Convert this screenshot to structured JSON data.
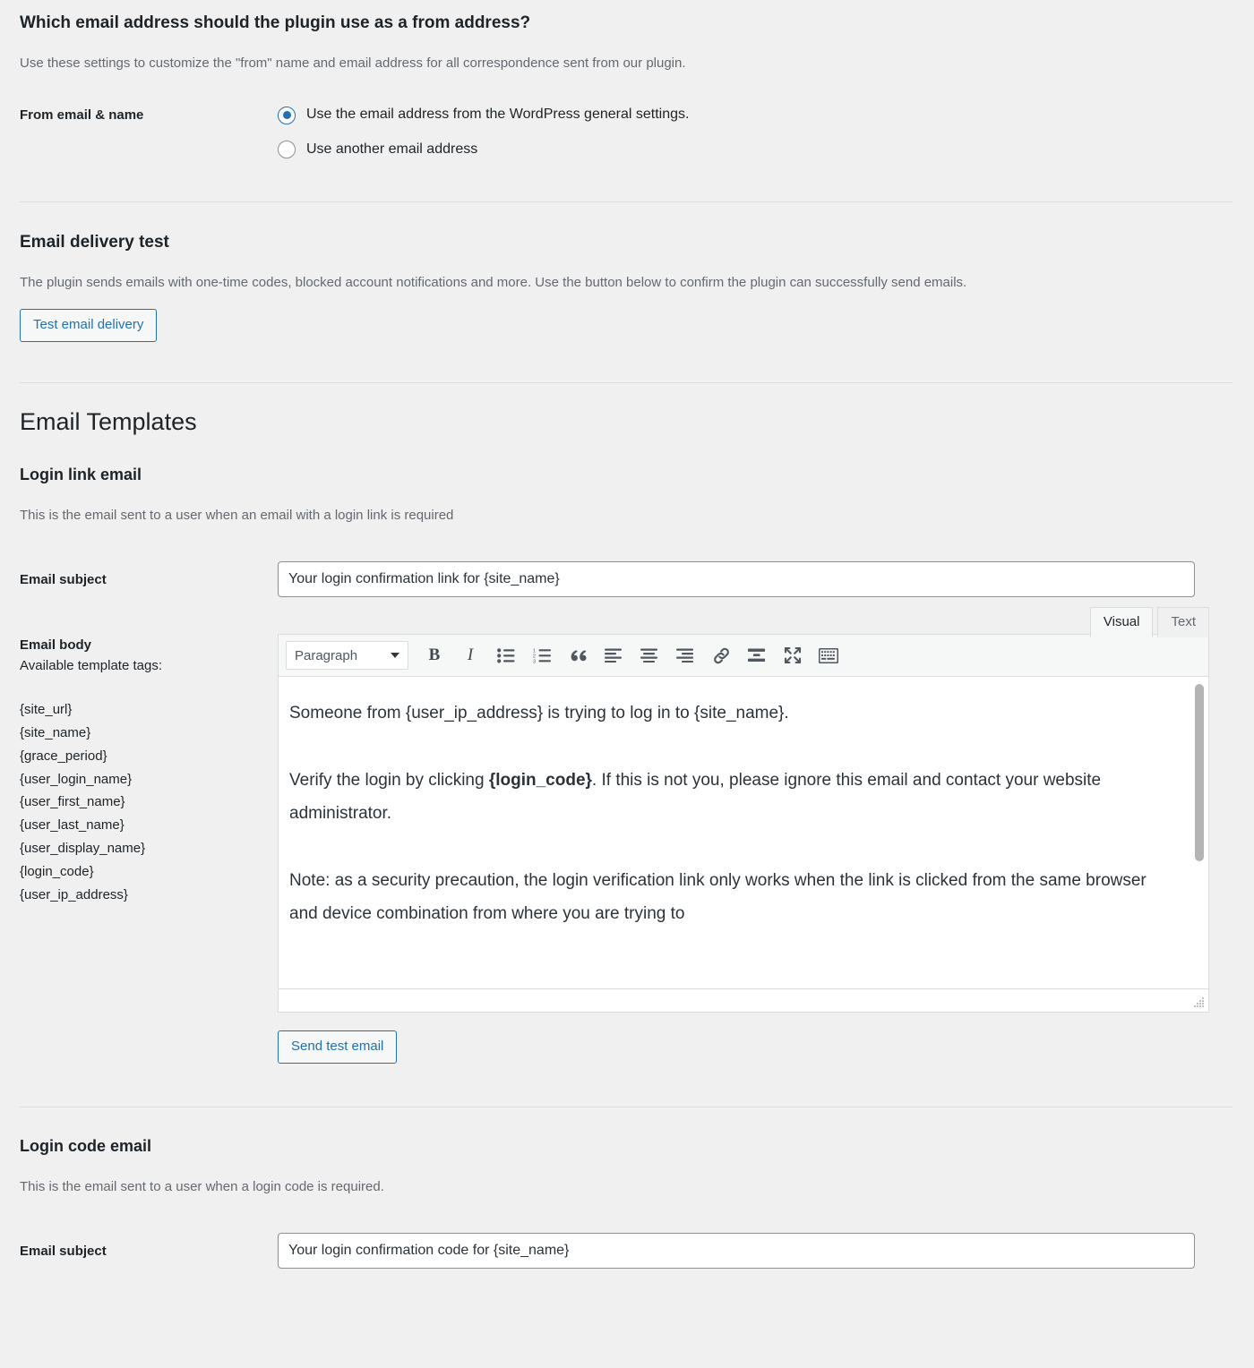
{
  "from_address_section": {
    "heading": "Which email address should the plugin use as a from address?",
    "description": "Use these settings to customize the \"from\" name and email address for all correspondence sent from our plugin.",
    "field_label": "From email & name",
    "options": [
      {
        "label": "Use the email address from the WordPress general settings.",
        "selected": true
      },
      {
        "label": "Use another email address",
        "selected": false
      }
    ]
  },
  "delivery_test_section": {
    "heading": "Email delivery test",
    "description": "The plugin sends emails with one-time codes, blocked account notifications and more. Use the button below to confirm the plugin can successfully send emails.",
    "button_label": "Test email delivery"
  },
  "email_templates": {
    "heading": "Email Templates",
    "login_link_email": {
      "heading": "Login link email",
      "description": "This is the email sent to a user when an email with a login link is required",
      "subject_label": "Email subject",
      "subject_value": "Your login confirmation link for {site_name}",
      "body_label": "Email body",
      "tags_label": "Available template tags:",
      "tags": [
        "{site_url}",
        "{site_name}",
        "{grace_period}",
        "{user_login_name}",
        "{user_first_name}",
        "{user_last_name}",
        "{user_display_name}",
        "{login_code}",
        "{user_ip_address}"
      ],
      "editor": {
        "tabs": [
          {
            "label": "Visual",
            "active": true
          },
          {
            "label": "Text",
            "active": false
          }
        ],
        "format_select_value": "Paragraph",
        "toolbar_buttons": [
          "bold-icon",
          "italic-icon",
          "bulleted-list-icon",
          "numbered-list-icon",
          "blockquote-icon",
          "align-left-icon",
          "align-center-icon",
          "align-right-icon",
          "link-icon",
          "insert-read-more-icon",
          "fullscreen-icon",
          "toolbar-toggle-icon"
        ],
        "paragraphs": [
          {
            "before": "Someone from {user_ip_address} is trying to log in to {site_name}.",
            "bold": "",
            "after": ""
          },
          {
            "before": "Verify the login by clicking ",
            "bold": "{login_code}",
            "after": ". If this is not you, please ignore this email and contact your website administrator."
          },
          {
            "before": "Note: as a security precaution, the login verification link only works when the link is clicked from the same browser and device combination from where you are trying to",
            "bold": "",
            "after": ""
          }
        ]
      },
      "send_test_label": "Send test email"
    },
    "login_code_email": {
      "heading": "Login code email",
      "description": "This is the email sent to a user when a login code is required.",
      "subject_label": "Email subject",
      "subject_value": "Your login confirmation code for {site_name}"
    }
  },
  "colors": {
    "page_background": "#f0f0f1",
    "accent_blue": "#2271b1",
    "text_primary": "#1d2327",
    "text_muted": "#646970",
    "border": "#dcdcde",
    "input_border": "#8c8f94"
  }
}
